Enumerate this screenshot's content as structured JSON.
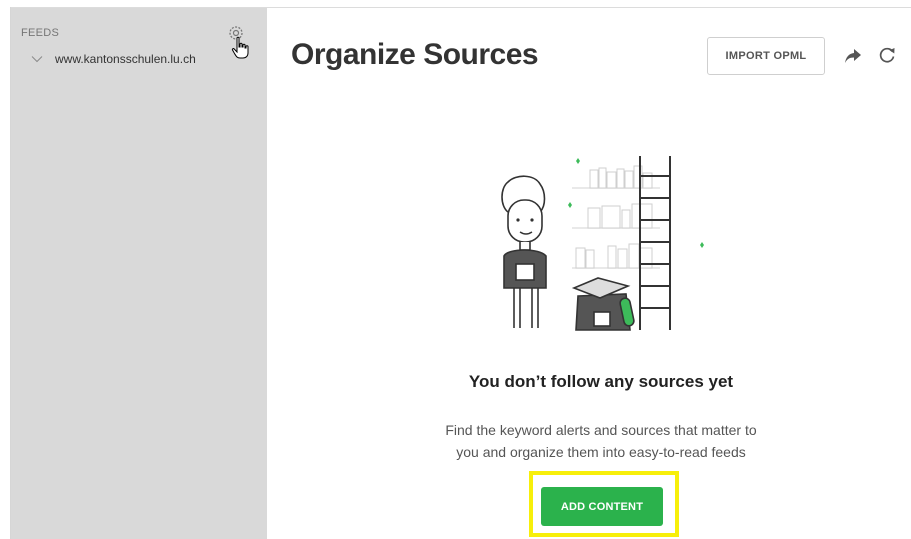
{
  "sidebar": {
    "section_label": "FEEDS",
    "items": [
      {
        "label": "www.kantonsschulen.lu.ch",
        "icon": "chevron-down-icon"
      }
    ],
    "settings_icon": "gear-icon",
    "cursor_icon": "hand-pointer-icon"
  },
  "header": {
    "title": "Organize Sources",
    "import_label": "IMPORT OPML",
    "share_icon": "share-arrow-icon",
    "refresh_icon": "refresh-icon"
  },
  "empty_state": {
    "illustration": "person-with-bookshelf-illustration",
    "title": "You don’t follow any sources yet",
    "line1": "Find the keyword alerts and sources that matter to",
    "line2": "you and organize them into easy-to-read feeds",
    "cta_label": "ADD CONTENT"
  },
  "colors": {
    "sidebar_bg": "#d9d9d9",
    "cta_green": "#2bb24c",
    "highlight_yellow": "#f7ef0a",
    "illustration_accent": "#3dbb5a"
  }
}
